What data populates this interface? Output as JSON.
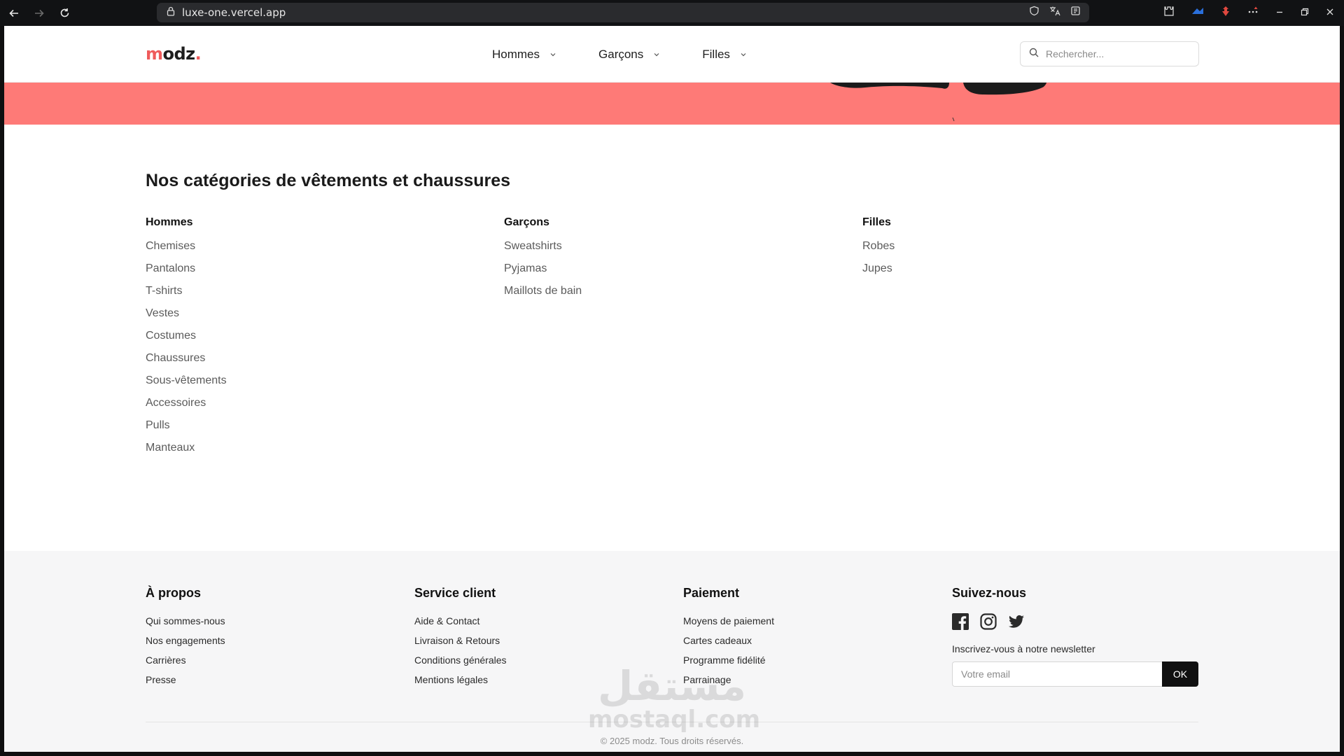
{
  "browser": {
    "url": "luxe-one.vercel.app"
  },
  "header": {
    "logo": {
      "first": "m",
      "rest": "odz",
      "dot": "."
    },
    "nav": [
      {
        "label": "Hommes"
      },
      {
        "label": "Garçons"
      },
      {
        "label": "Filles"
      }
    ],
    "search_placeholder": "Rechercher..."
  },
  "categories": {
    "title": "Nos catégories de vêtements et chaussures",
    "columns": [
      {
        "heading": "Hommes",
        "items": [
          "Chemises",
          "Pantalons",
          "T-shirts",
          "Vestes",
          "Costumes",
          "Chaussures",
          "Sous-vêtements",
          "Accessoires",
          "Pulls",
          "Manteaux"
        ]
      },
      {
        "heading": "Garçons",
        "items": [
          "Sweatshirts",
          "Pyjamas",
          "Maillots de bain"
        ]
      },
      {
        "heading": "Filles",
        "items": [
          "Robes",
          "Jupes"
        ]
      }
    ]
  },
  "footer": {
    "columns": [
      {
        "heading": "À propos",
        "items": [
          "Qui sommes-nous",
          "Nos engagements",
          "Carrières",
          "Presse"
        ]
      },
      {
        "heading": "Service client",
        "items": [
          "Aide & Contact",
          "Livraison & Retours",
          "Conditions générales",
          "Mentions légales"
        ]
      },
      {
        "heading": "Paiement",
        "items": [
          "Moyens de paiement",
          "Cartes cadeaux",
          "Programme fidélité",
          "Parrainage"
        ]
      }
    ],
    "social": {
      "heading": "Suivez-nous",
      "icons": [
        "facebook-icon",
        "instagram-icon",
        "twitter-icon"
      ],
      "newsletter_label": "Inscrivez-vous à notre newsletter",
      "email_placeholder": "Votre email",
      "submit_label": "OK"
    },
    "copyright": "© 2025 modz. Tous droits réservés."
  },
  "watermark": {
    "arabic": "مستقل",
    "latin": "mostaql.com"
  },
  "colors": {
    "accent": "#ef5b5b",
    "hero": "#fe7a77",
    "footer_bg": "#f6f6f7",
    "button": "#111111"
  }
}
